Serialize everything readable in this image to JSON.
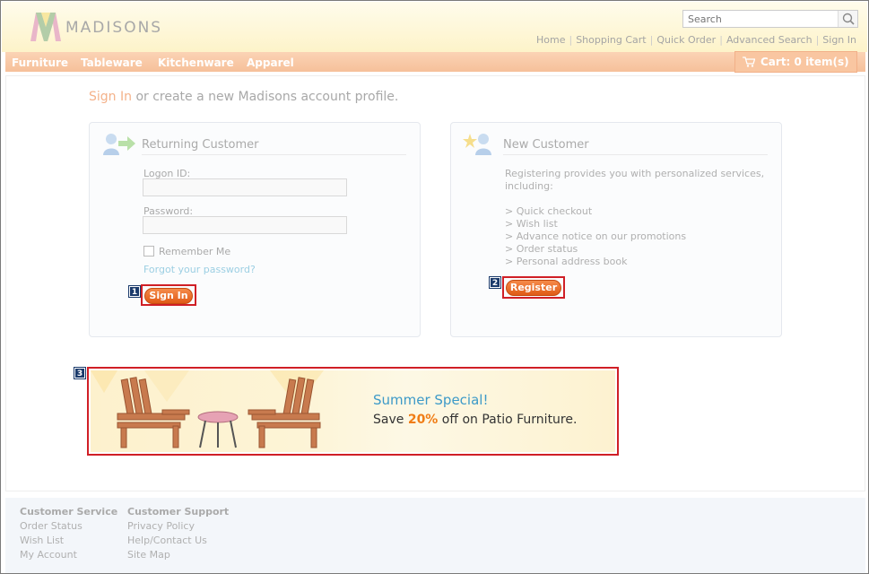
{
  "header": {
    "logo_text": "MADISONS",
    "search_placeholder": "Search",
    "utility_nav": [
      "Home",
      "Shopping Cart",
      "Quick Order",
      "Advanced Search",
      "Sign In"
    ]
  },
  "categories": [
    "Furniture",
    "Tableware",
    "Kitchenware",
    "Apparel"
  ],
  "cart": {
    "label": "Cart: 0 item(s)"
  },
  "intro": {
    "signin_link": "Sign In",
    "rest": " or create a new Madisons account profile."
  },
  "returning": {
    "title": "Returning Customer",
    "logon_label": "Logon ID:",
    "logon_value": "",
    "password_label": "Password:",
    "password_value": "",
    "remember_label": "Remember Me",
    "forgot_link": "Forgot your password?",
    "signin_button": "Sign In"
  },
  "new_customer": {
    "title": "New Customer",
    "description_line1": "Registering provides you with personalized services,",
    "description_line2": "including:",
    "benefits": [
      "> Quick checkout",
      "> Wish list",
      "> Advance notice on our promotions",
      "> Order status",
      "> Personal address book"
    ],
    "register_button": "Register"
  },
  "markers": [
    "1",
    "2",
    "3"
  ],
  "banner": {
    "title": "Summer Special!",
    "sub_before": "Save ",
    "sub_pct": "20%",
    "sub_after": " off on Patio Furniture."
  },
  "footer": {
    "col1": {
      "heading": "Customer Service",
      "links": [
        "Order Status",
        "Wish List",
        "My Account"
      ]
    },
    "col2": {
      "heading": "Customer Support",
      "links": [
        "Privacy Policy",
        "Help/Contact Us",
        "Site Map"
      ]
    }
  },
  "colors": {
    "accent_orange": "#e05a16",
    "highlight_red": "#d01f26",
    "marker_navy": "#1a3a6b"
  }
}
